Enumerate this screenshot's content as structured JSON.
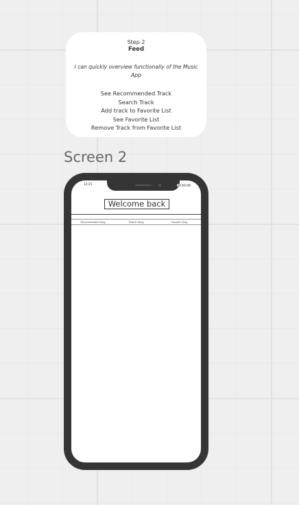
{
  "card": {
    "step": "Step 2",
    "title": "Feed",
    "description": "I can quickly overview functionally of the Music App",
    "features": [
      "See Recommended Track",
      "Search Track",
      "Add track to Favorite List",
      "See Favorite List",
      "Remove Track from Favorite List"
    ]
  },
  "screen_label": "Screen 2",
  "phone": {
    "time": "12:21",
    "welcome": "Welcome back",
    "tabs": [
      "Recommended Song",
      "Search Song",
      "Favorite Song"
    ]
  },
  "colors": {
    "canvas": "#efefef",
    "grid": "#e2e2e2",
    "phone_frame": "#353535",
    "card": "#ffffff"
  }
}
